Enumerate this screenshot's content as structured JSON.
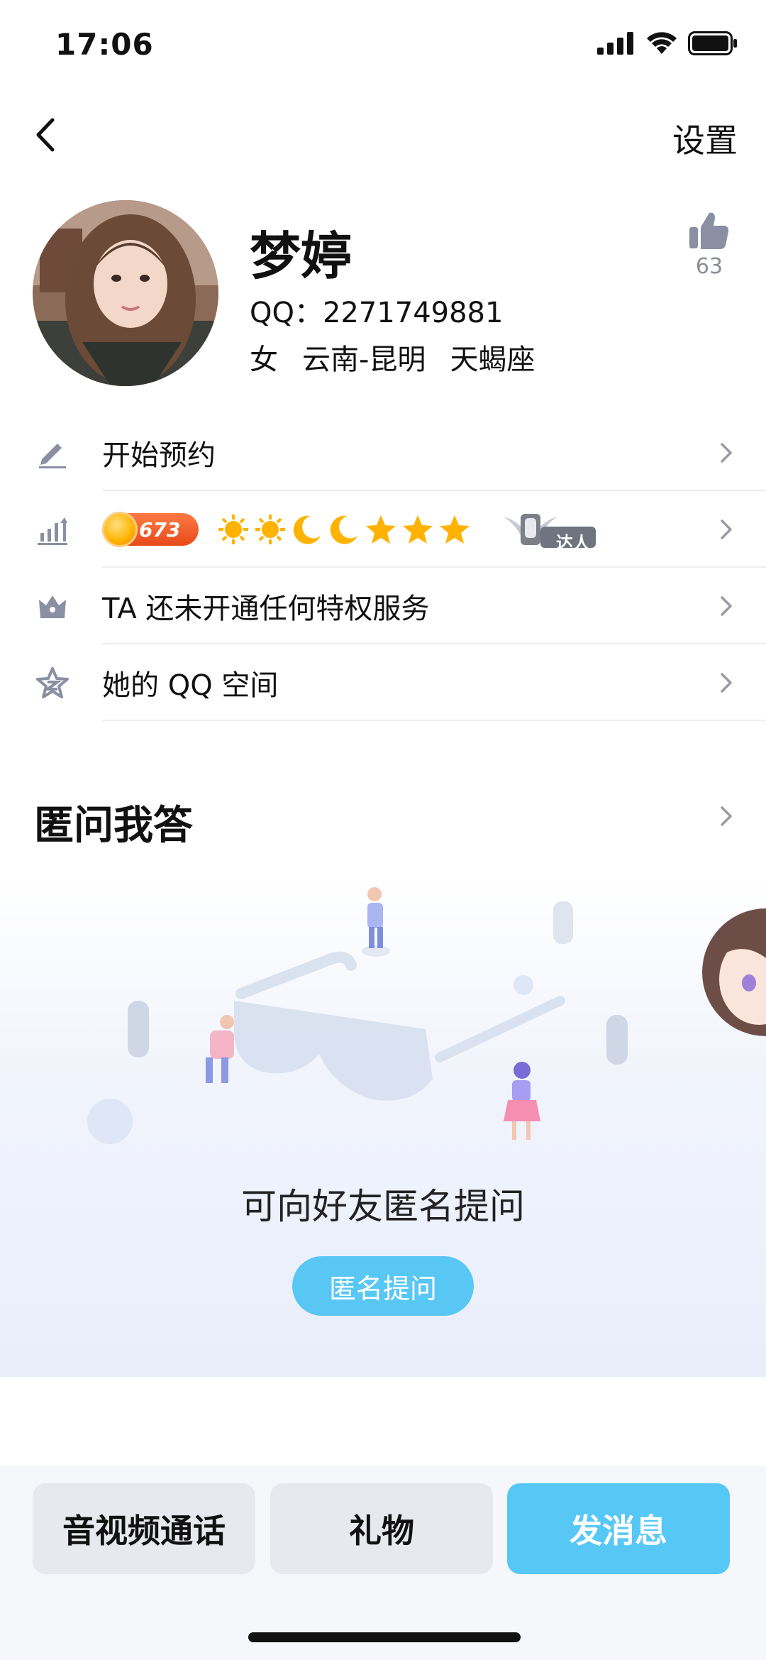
{
  "status_bar": {
    "time": "17:06"
  },
  "nav": {
    "settings_label": "设置"
  },
  "profile": {
    "name": "梦婷",
    "qq_label": "QQ：2271749881",
    "gender": "女",
    "location": "云南-昆明",
    "zodiac": "天蝎座",
    "like_count": "63"
  },
  "list": {
    "appointment_label": "开始预约",
    "coin_value": "673",
    "talent_label": "达人",
    "privilege_label": "TA 还未开通任何特权服务",
    "qzone_label": "她的 QQ 空间"
  },
  "qa_section": {
    "title": "匿问我答",
    "prompt": "可向好友匿名提问",
    "ask_button": "匿名提问"
  },
  "bottom_bar": {
    "call_label": "音视频通话",
    "gift_label": "礼物",
    "message_label": "发消息"
  },
  "colors": {
    "accent_blue": "#57c8f5",
    "icon_grey": "#8a8fa3",
    "divider": "#eceef2"
  }
}
